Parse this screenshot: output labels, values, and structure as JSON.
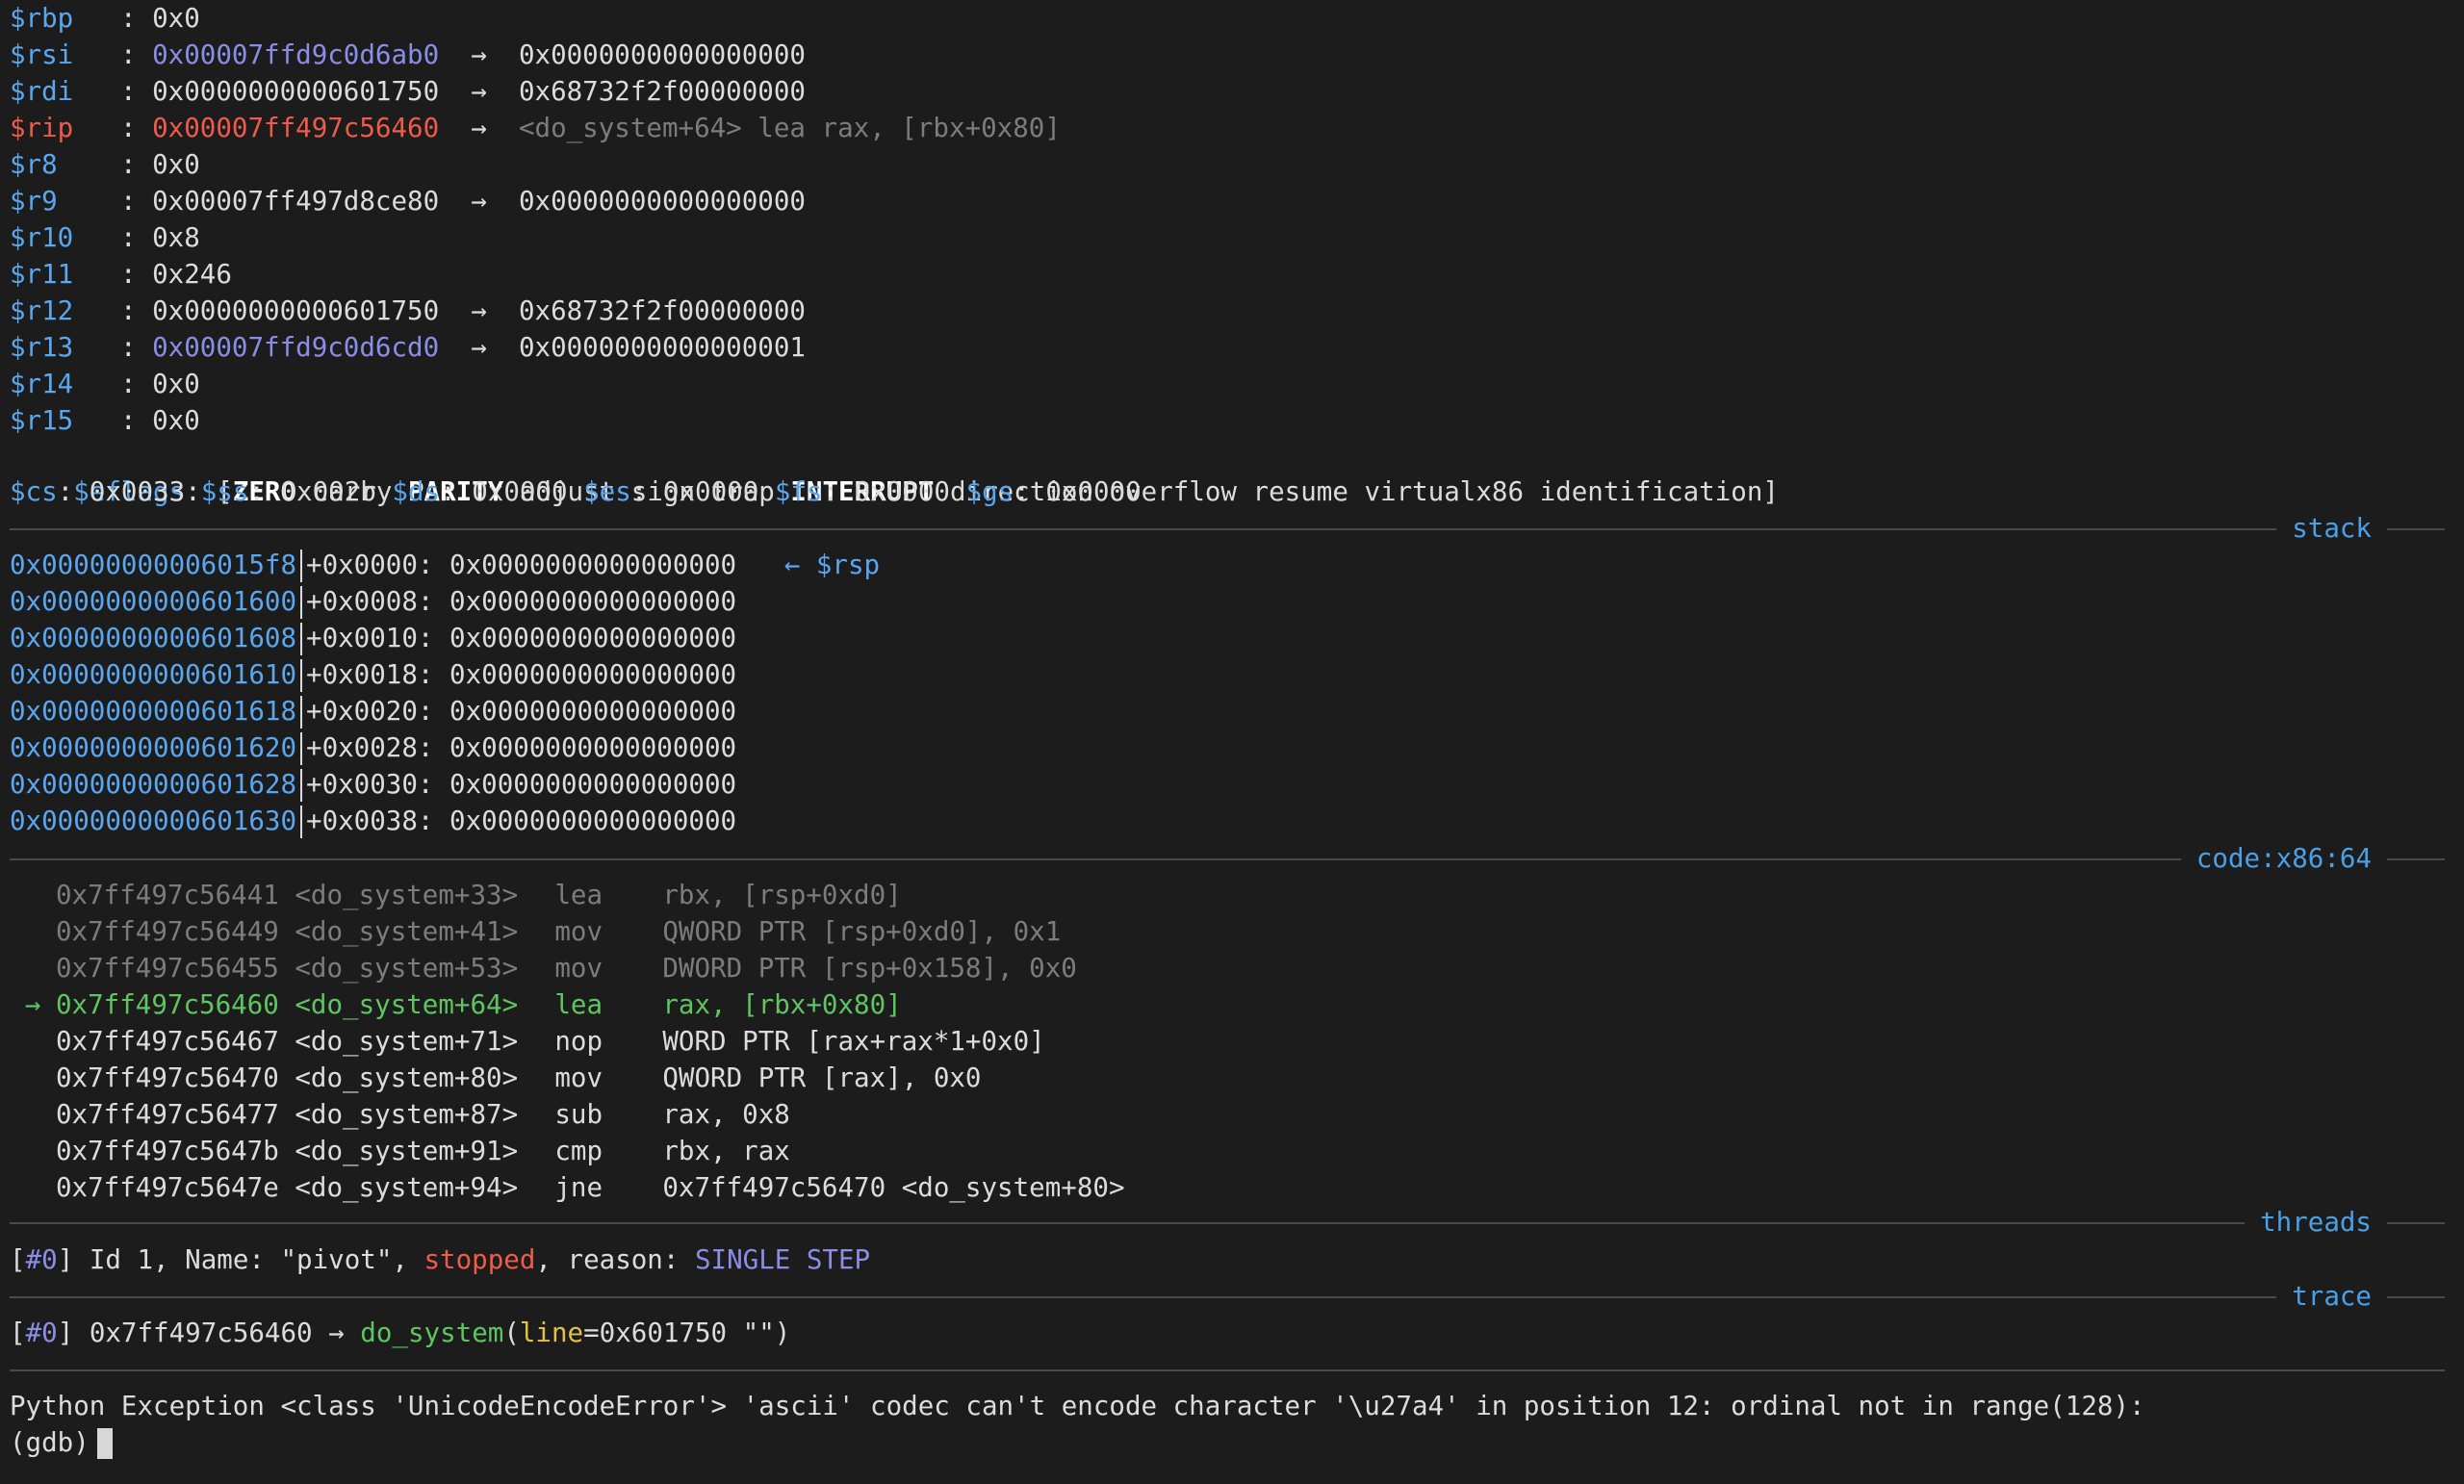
{
  "registers": [
    {
      "name": "$rbp",
      "name_class": "blue",
      "value": "0x0",
      "value_class": "",
      "target": "",
      "target_class": ""
    },
    {
      "name": "$rsi",
      "name_class": "blue",
      "value": "0x00007ffd9c0d6ab0",
      "value_class": "purple",
      "target": "0x0000000000000000",
      "target_class": ""
    },
    {
      "name": "$rdi",
      "name_class": "blue",
      "value": "0x0000000000601750",
      "value_class": "",
      "target": "0x68732f2f00000000",
      "target_class": ""
    },
    {
      "name": "$rip",
      "name_class": "red",
      "value": "0x00007ff497c56460",
      "value_class": "red",
      "target": "<do_system+64> lea rax, [rbx+0x80]",
      "target_class": "gray"
    },
    {
      "name": "$r8",
      "name_class": "blue",
      "value": "0x0",
      "value_class": "",
      "target": "",
      "target_class": ""
    },
    {
      "name": "$r9",
      "name_class": "blue",
      "value": "0x00007ff497d8ce80",
      "value_class": "",
      "target": "0x0000000000000000",
      "target_class": ""
    },
    {
      "name": "$r10",
      "name_class": "blue",
      "value": "0x8",
      "value_class": "",
      "target": "",
      "target_class": ""
    },
    {
      "name": "$r11",
      "name_class": "blue",
      "value": "0x246",
      "value_class": "",
      "target": "",
      "target_class": ""
    },
    {
      "name": "$r12",
      "name_class": "blue",
      "value": "0x0000000000601750",
      "value_class": "",
      "target": "0x68732f2f00000000",
      "target_class": ""
    },
    {
      "name": "$r13",
      "name_class": "blue",
      "value": "0x00007ffd9c0d6cd0",
      "value_class": "purple",
      "target": "0x0000000000000001",
      "target_class": ""
    },
    {
      "name": "$r14",
      "name_class": "blue",
      "value": "0x0",
      "value_class": "",
      "target": "",
      "target_class": ""
    },
    {
      "name": "$r15",
      "name_class": "blue",
      "value": "0x0",
      "value_class": "",
      "target": "",
      "target_class": ""
    }
  ],
  "arrow": "→",
  "eflags": {
    "label": "$eflags",
    "flags": [
      {
        "text": "ZERO",
        "set": true
      },
      {
        "text": "carry",
        "set": false
      },
      {
        "text": "PARITY",
        "set": true
      },
      {
        "text": "adjust",
        "set": false
      },
      {
        "text": "sign",
        "set": false
      },
      {
        "text": "trap",
        "set": false
      },
      {
        "text": "INTERRUPT",
        "set": true
      },
      {
        "text": "direction",
        "set": false
      },
      {
        "text": "overflow",
        "set": false
      },
      {
        "text": "resume",
        "set": false
      },
      {
        "text": "virtualx86",
        "set": false
      },
      {
        "text": "identification",
        "set": false
      }
    ]
  },
  "segments": [
    {
      "name": "$cs",
      "value": "0x0033"
    },
    {
      "name": "$ss",
      "value": "0x002b"
    },
    {
      "name": "$ds",
      "value": "0x0000"
    },
    {
      "name": "$es",
      "value": "0x0000"
    },
    {
      "name": "$fs",
      "value": "0x0000"
    },
    {
      "name": "$gs",
      "value": "0x0000"
    }
  ],
  "sections": {
    "stack": "stack",
    "code": "code:x86:64",
    "threads": "threads",
    "trace": "trace"
  },
  "stack": [
    {
      "addr": "0x00000000006015f8",
      "offset": "+0x0000",
      "value": "0x0000000000000000",
      "note": "← $rsp"
    },
    {
      "addr": "0x0000000000601600",
      "offset": "+0x0008",
      "value": "0x0000000000000000",
      "note": ""
    },
    {
      "addr": "0x0000000000601608",
      "offset": "+0x0010",
      "value": "0x0000000000000000",
      "note": ""
    },
    {
      "addr": "0x0000000000601610",
      "offset": "+0x0018",
      "value": "0x0000000000000000",
      "note": ""
    },
    {
      "addr": "0x0000000000601618",
      "offset": "+0x0020",
      "value": "0x0000000000000000",
      "note": ""
    },
    {
      "addr": "0x0000000000601620",
      "offset": "+0x0028",
      "value": "0x0000000000000000",
      "note": ""
    },
    {
      "addr": "0x0000000000601628",
      "offset": "+0x0030",
      "value": "0x0000000000000000",
      "note": ""
    },
    {
      "addr": "0x0000000000601630",
      "offset": "+0x0038",
      "value": "0x0000000000000000",
      "note": ""
    }
  ],
  "code": [
    {
      "marker": "",
      "addr": "0x7ff497c56441",
      "sym": "<do_system+33>",
      "op": "lea",
      "args": "rbx, [rsp+0xd0]",
      "state": "past"
    },
    {
      "marker": "",
      "addr": "0x7ff497c56449",
      "sym": "<do_system+41>",
      "op": "mov",
      "args": "QWORD PTR [rsp+0xd0], 0x1",
      "state": "past"
    },
    {
      "marker": "",
      "addr": "0x7ff497c56455",
      "sym": "<do_system+53>",
      "op": "mov",
      "args": "DWORD PTR [rsp+0x158], 0x0",
      "state": "past"
    },
    {
      "marker": "→",
      "addr": "0x7ff497c56460",
      "sym": "<do_system+64>",
      "op": "lea",
      "args": "rax, [rbx+0x80]",
      "state": "current"
    },
    {
      "marker": "",
      "addr": "0x7ff497c56467",
      "sym": "<do_system+71>",
      "op": "nop",
      "args": "WORD PTR [rax+rax*1+0x0]",
      "state": "next"
    },
    {
      "marker": "",
      "addr": "0x7ff497c56470",
      "sym": "<do_system+80>",
      "op": "mov",
      "args": "QWORD PTR [rax], 0x0",
      "state": "next"
    },
    {
      "marker": "",
      "addr": "0x7ff497c56477",
      "sym": "<do_system+87>",
      "op": "sub",
      "args": "rax, 0x8",
      "state": "next"
    },
    {
      "marker": "",
      "addr": "0x7ff497c5647b",
      "sym": "<do_system+91>",
      "op": "cmp",
      "args": "rbx, rax",
      "state": "next"
    },
    {
      "marker": "",
      "addr": "0x7ff497c5647e",
      "sym": "<do_system+94>",
      "op": "jne",
      "args": "0x7ff497c56470 <do_system+80>",
      "state": "next"
    }
  ],
  "thread": {
    "index": "#0",
    "prefix": "Id 1, Name: \"pivot\", ",
    "state": "stopped",
    "mid": ", reason: ",
    "reason": "SINGLE STEP"
  },
  "trace": {
    "index": "#0",
    "addr": "0x7ff497c56460",
    "func": "do_system",
    "param": "line",
    "param_value": "=0x601750 \"\""
  },
  "exception": "Python Exception <class 'UnicodeEncodeError'> 'ascii' codec can't encode character '\\u27a4' in position 12: ordinal not in range(128):",
  "prompt": "(gdb)"
}
